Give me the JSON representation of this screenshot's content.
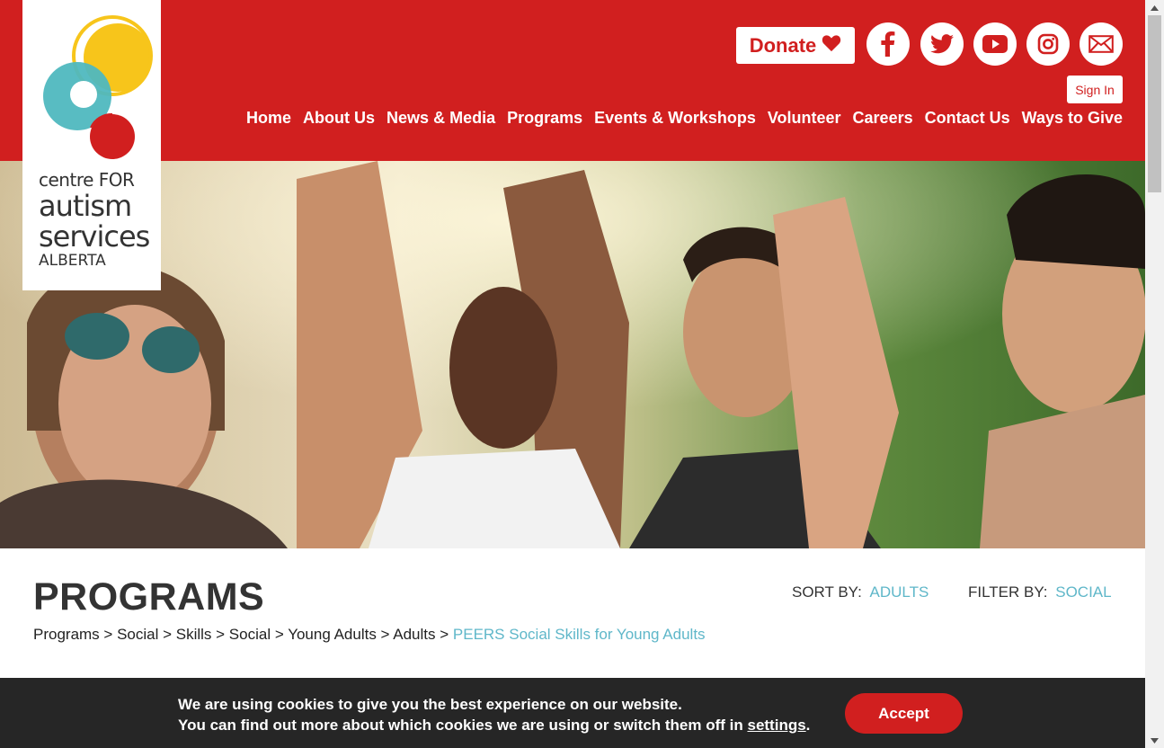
{
  "logo": {
    "line1": "centre FOR",
    "line2": "autism",
    "line3": "services",
    "line4": "ALBERTA"
  },
  "header": {
    "donate_label": "Donate",
    "signin_label": "Sign In",
    "social": [
      "facebook-icon",
      "twitter-icon",
      "youtube-icon",
      "instagram-icon",
      "email-icon"
    ]
  },
  "nav": {
    "items": [
      {
        "label": "Home"
      },
      {
        "label": "About Us"
      },
      {
        "label": "News & Media"
      },
      {
        "label": "Programs"
      },
      {
        "label": "Events & Workshops"
      },
      {
        "label": "Volunteer"
      },
      {
        "label": "Careers"
      },
      {
        "label": "Contact Us"
      },
      {
        "label": "Ways to Give"
      }
    ]
  },
  "main": {
    "title": "PROGRAMS",
    "sort_label": "SORT BY:",
    "sort_value": "ADULTS",
    "filter_label": "FILTER BY:",
    "filter_value": "SOCIAL",
    "breadcrumb": [
      "Programs",
      "Social",
      "Skills",
      "Social",
      "Young Adults",
      "Adults"
    ],
    "breadcrumb_sep": " > ",
    "breadcrumb_current": "PEERS Social Skills for Young Adults"
  },
  "cookie": {
    "line1": "We are using cookies to give you the best experience on our website.",
    "line2_prefix": "You can find out more about which cookies we are using or switch them off in ",
    "settings_link": "settings",
    "line2_suffix": ".",
    "accept_label": "Accept"
  },
  "colors": {
    "brand_red": "#d11f1f",
    "accent_teal": "#5fb7c9",
    "cookie_bg": "#262626"
  }
}
